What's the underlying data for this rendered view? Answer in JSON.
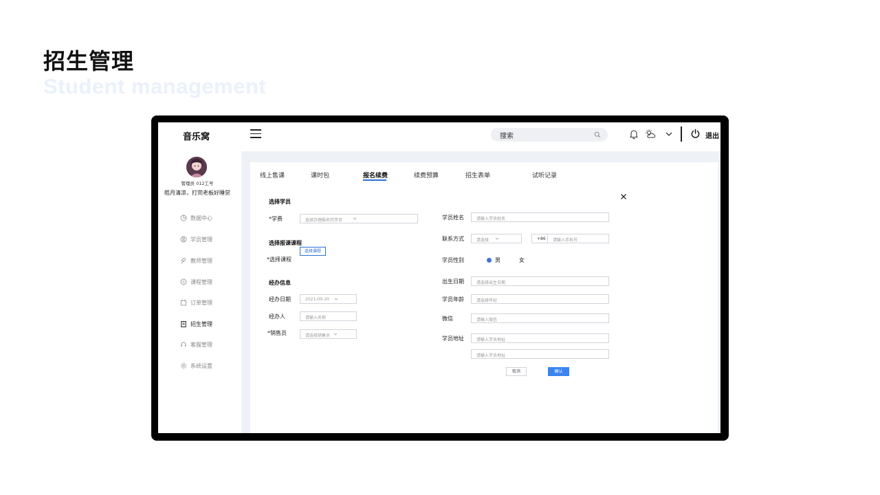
{
  "slide": {
    "title": "招生管理",
    "subtitle": "Student management"
  },
  "topbar": {
    "app_name": "音乐窝",
    "search_placeholder": "搜索",
    "logout_label": "退出"
  },
  "sidebar": {
    "user_id": "管理员 012工号",
    "motto": "皓月清凉，打完老板好睡觉",
    "items": [
      {
        "label": "数据中心",
        "icon": "pie-chart-icon"
      },
      {
        "label": "学员管理",
        "icon": "user-circle-icon"
      },
      {
        "label": "教师管理",
        "icon": "teacher-icon"
      },
      {
        "label": "课程管理",
        "icon": "course-icon"
      },
      {
        "label": "订单管理",
        "icon": "order-icon"
      },
      {
        "label": "招生管理",
        "icon": "enroll-icon"
      },
      {
        "label": "客服管理",
        "icon": "headset-icon"
      },
      {
        "label": "系统设置",
        "icon": "gear-icon"
      }
    ],
    "active": "招生管理"
  },
  "tabs": [
    {
      "label": "线上售课"
    },
    {
      "label": "课时包"
    },
    {
      "label": "报名续费"
    },
    {
      "label": "续费预算"
    },
    {
      "label": "招生表单"
    },
    {
      "label": "试听记录"
    }
  ],
  "active_tab": "报名续费",
  "form": {
    "section_student": "选择学员",
    "student_label": "*学费",
    "student_placeholder": "选择办理报名的学员",
    "section_course": "选择报课课程",
    "course_label": "*选择课程",
    "course_button": "选择课程",
    "section_handler": "经办信息",
    "date_label": "经办日期",
    "date_value": "2021-09-20",
    "handler_label": "经办人",
    "handler_placeholder": "请输入名称",
    "sales_label": "*销售员",
    "sales_placeholder": "请选择销售员",
    "name_label": "学员姓名",
    "name_placeholder": "请输入学员姓名",
    "contact_label": "联系方式",
    "contact_select": "请选择",
    "phone_prefix": "+86",
    "phone_placeholder": "请输入手机号",
    "gender_label": "学员性别",
    "gender_male": "男",
    "gender_female": "女",
    "gender_selected": "男",
    "birth_label": "出生日期",
    "birth_placeholder": "请选择出生日期",
    "age_label": "学员年龄",
    "age_placeholder": "请选择年纪",
    "wechat_label": "微信",
    "wechat_placeholder": "请输入微信",
    "address_label": "学员地址",
    "address_placeholder_1": "请输入学员地址",
    "address_placeholder_2": "请输入学员地址",
    "cancel_label": "取消",
    "confirm_label": "确认"
  },
  "colors": {
    "accent": "#2a6fd6",
    "confirm": "#3a84f0",
    "content_bg": "#eef1f6",
    "subtitle": "#eaf1fb"
  }
}
